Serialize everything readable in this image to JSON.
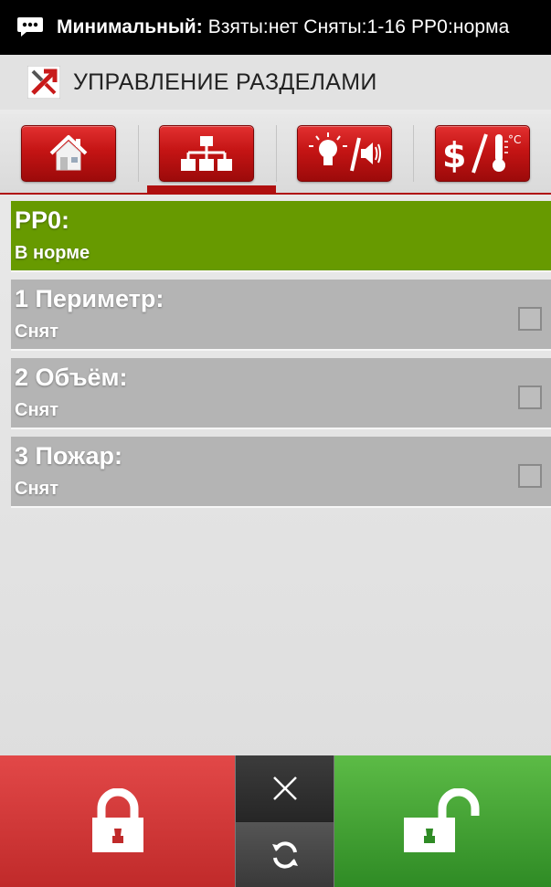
{
  "status_bar": {
    "mode_label": "Минимальный:",
    "status_text": "Взяты:нет  Сняты:1-16  PP0:норма",
    "notification_icon": "chat-bubble-icon"
  },
  "action_bar": {
    "title": "УПРАВЛЕНИЕ РАЗДЕЛАМИ",
    "logo_icon": "app-logo-icon"
  },
  "tabs": [
    {
      "icon": "house-icon",
      "active": false
    },
    {
      "icon": "hierarchy-icon",
      "active": true
    },
    {
      "icon": "lightbulb-speaker-icon",
      "active": false
    },
    {
      "icon": "dollar-thermometer-icon",
      "active": false
    }
  ],
  "partitions": [
    {
      "name": "PP0:",
      "state": "В норме",
      "checkbox": false,
      "status": "ok"
    },
    {
      "name": "1 Периметр:",
      "state": "Снят",
      "checkbox": true,
      "status": "disarmed"
    },
    {
      "name": "2 Объём:",
      "state": "Снят",
      "checkbox": true,
      "status": "disarmed"
    },
    {
      "name": "3 Пожар:",
      "state": "Снят",
      "checkbox": true,
      "status": "disarmed"
    }
  ],
  "bottom_bar": {
    "arm_icon": "lock-closed-icon",
    "cancel_icon": "close-icon",
    "refresh_icon": "refresh-icon",
    "disarm_icon": "lock-open-icon"
  },
  "colors": {
    "accent_red": "#c41414",
    "ok_green": "#679a00",
    "disarmed_gray": "#b4b4b4",
    "arm_red": "#d83a3a",
    "disarm_green": "#43a232"
  }
}
